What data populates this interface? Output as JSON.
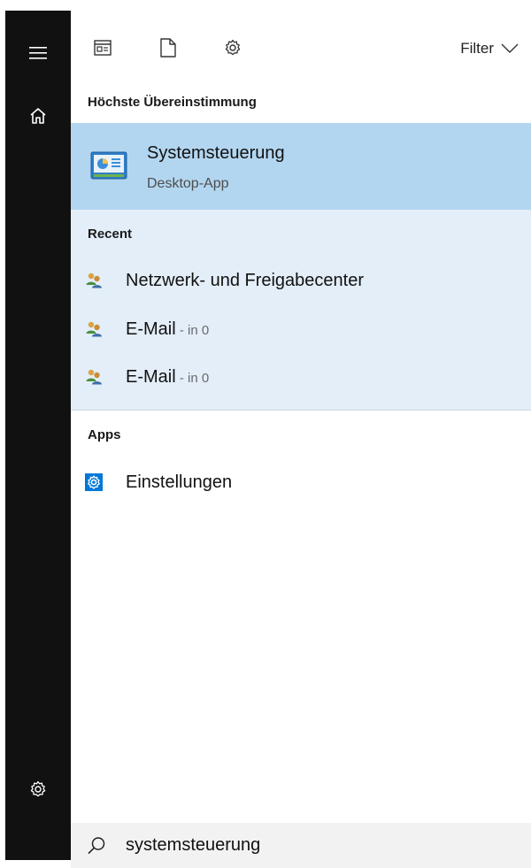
{
  "topbar": {
    "icons": [
      "document-view-icon",
      "document-icon",
      "settings-gear-icon"
    ],
    "filter_label": "Filter"
  },
  "best_match": {
    "heading": "Höchste Übereinstimmung",
    "title": "Systemsteuerung",
    "subtitle": "Desktop-App",
    "icon": "control-panel-icon"
  },
  "recent": {
    "heading": "Recent",
    "items": [
      {
        "label": "Netzwerk- und Freigabecenter",
        "suffix": "",
        "icon": "users-icon"
      },
      {
        "label": "E-Mail",
        "suffix": " - in 0",
        "icon": "users-icon"
      },
      {
        "label": "E-Mail",
        "suffix": " - in 0",
        "icon": "users-icon"
      }
    ]
  },
  "apps": {
    "heading": "Apps",
    "items": [
      {
        "label": "Einstellungen",
        "icon": "settings-app-icon"
      }
    ]
  },
  "rail": {
    "icons": [
      "hamburger-menu-icon",
      "home-icon",
      "settings-gear-icon"
    ]
  },
  "search": {
    "value": "systemsteuerung",
    "placeholder": ""
  },
  "colors": {
    "rail_bg": "#111111",
    "best_match_bg": "#b3d6f0",
    "recent_bg": "#e3eef8",
    "search_bg": "#f2f2f2",
    "accent": "#0078d7"
  }
}
